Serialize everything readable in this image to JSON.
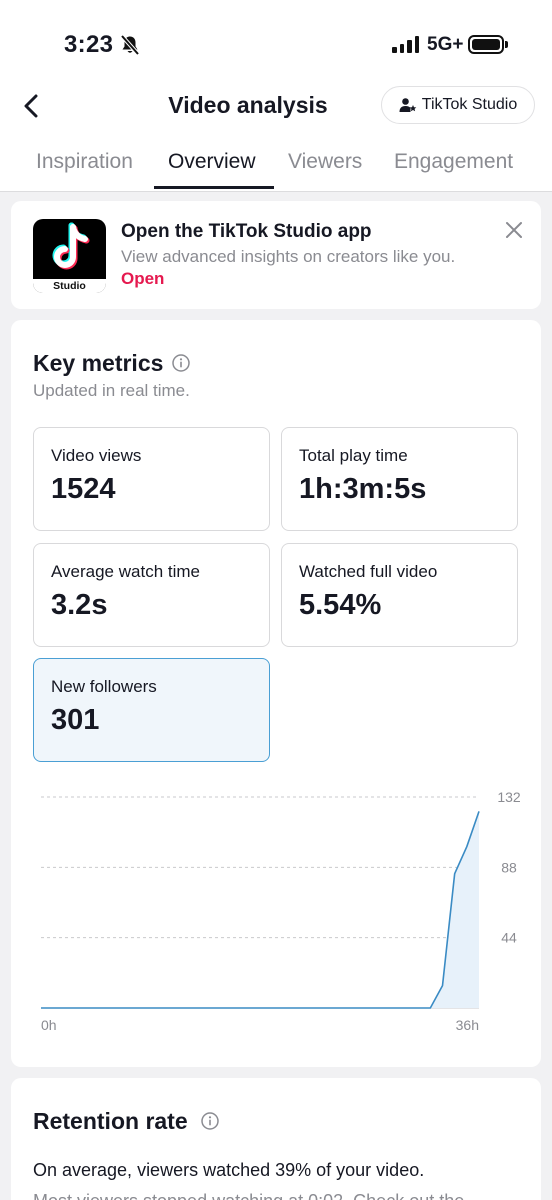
{
  "status_bar": {
    "time": "3:23",
    "network": "5G+"
  },
  "header": {
    "title": "Video analysis",
    "studio_button": "TikTok Studio"
  },
  "tabs": [
    {
      "label": "Inspiration",
      "active": false
    },
    {
      "label": "Overview",
      "active": true
    },
    {
      "label": "Viewers",
      "active": false
    },
    {
      "label": "Engagement",
      "active": false
    }
  ],
  "promo": {
    "app_label": "Studio",
    "title": "Open the TikTok Studio app",
    "subtitle": "View advanced insights on creators like you.",
    "link": "Open"
  },
  "key_metrics": {
    "title": "Key metrics",
    "subtitle": "Updated in real time.",
    "tiles": [
      {
        "label": "Video views",
        "value": "1524"
      },
      {
        "label": "Total play time",
        "value": "1h:3m:5s"
      },
      {
        "label": "Average watch time",
        "value": "3.2s"
      },
      {
        "label": "Watched full video",
        "value": "5.54%"
      },
      {
        "label": "New followers",
        "value": "301",
        "selected": true
      }
    ]
  },
  "chart_data": {
    "type": "area",
    "series": [
      {
        "x": [
          0,
          31,
          32,
          33,
          34,
          35,
          36
        ],
        "values": [
          0,
          0,
          0,
          14,
          84,
          101,
          123
        ]
      }
    ],
    "x_tick_labels": [
      "0h",
      "36h"
    ],
    "xlim": [
      0,
      36
    ],
    "y_tick_values": [
      44,
      88,
      132
    ],
    "ylim": [
      0,
      132
    ],
    "grid": true,
    "colors": {
      "line": "#3a8bc4",
      "fill": "#e7f1fa",
      "grid": "#c9c9cc"
    }
  },
  "retention": {
    "title": "Retention rate",
    "line1": "On average, viewers watched 39% of your video.",
    "line2": "Most viewers stopped watching at 0:02. Check out the"
  }
}
